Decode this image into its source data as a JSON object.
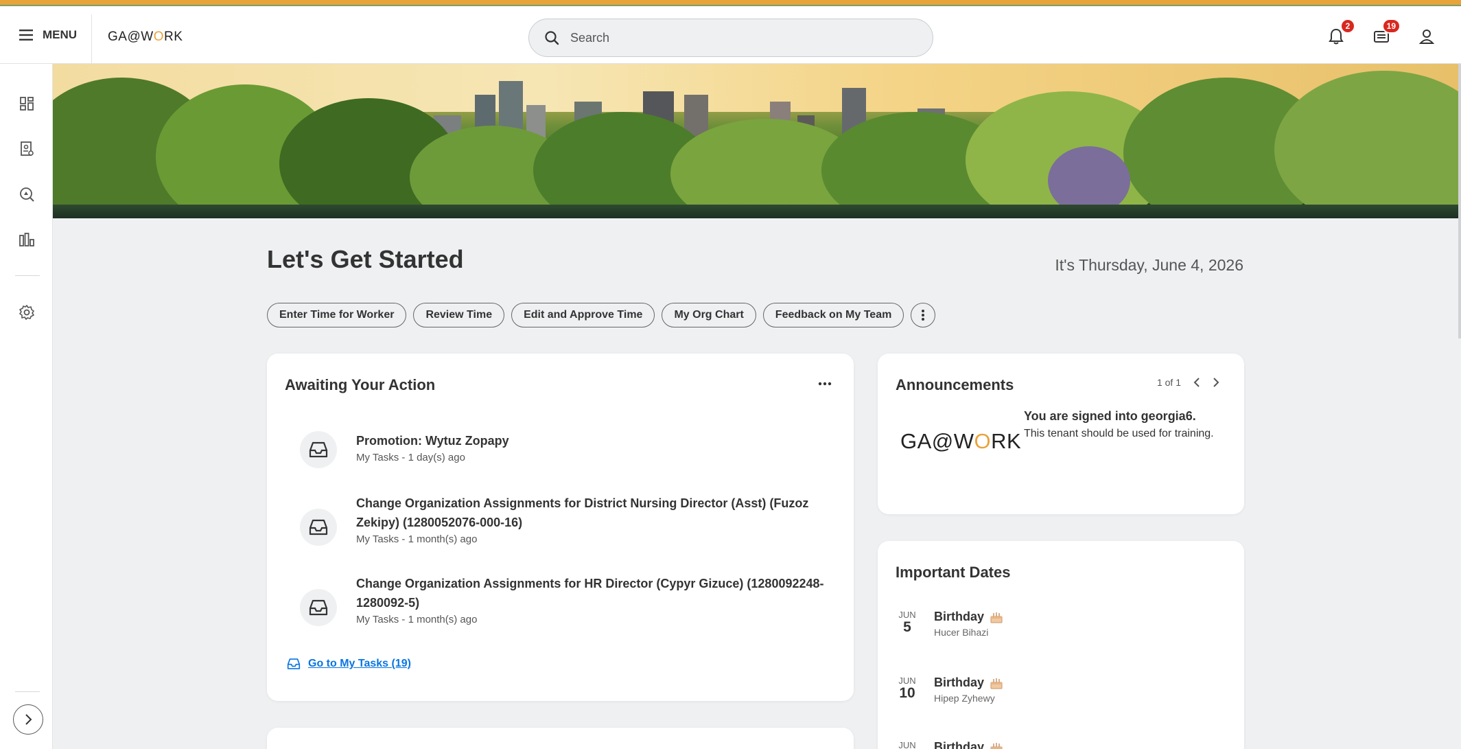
{
  "topbar": {
    "menu_label": "MENU",
    "logo": {
      "prefix": "GA@W",
      "o": "O",
      "suffix": "RK"
    },
    "search_placeholder": "Search",
    "notifications_count": "2",
    "inbox_count": "19"
  },
  "main": {
    "title": "Let's Get Started",
    "date": "It's Thursday, June 4, 2026",
    "quick_actions": [
      "Enter Time for Worker",
      "Review Time",
      "Edit and Approve Time",
      "My Org Chart",
      "Feedback on My Team"
    ]
  },
  "awaiting": {
    "title": "Awaiting Your Action",
    "tasks": [
      {
        "title": "Promotion: Wytuz Zopapy",
        "sub": "My Tasks - 1 day(s) ago"
      },
      {
        "title": "Change Organization Assignments for District Nursing Director (Asst) (Fuzoz Zekipy) (1280052076-000-16)",
        "sub": "My Tasks - 1 month(s) ago"
      },
      {
        "title": "Change Organization Assignments for HR Director (Cypyr Gizuce) (1280092248-1280092-5)",
        "sub": "My Tasks - 1 month(s) ago"
      }
    ],
    "goto_label": "Go to My Tasks (19)"
  },
  "announcements": {
    "title": "Announcements",
    "pager": "1 of 1",
    "heading": "You are signed into georgia6.",
    "body": "This tenant should be used for training."
  },
  "important_dates": {
    "title": "Important Dates",
    "items": [
      {
        "month": "JUN",
        "day": "5",
        "event": "Birthday",
        "person": "Hucer Bihazi"
      },
      {
        "month": "JUN",
        "day": "10",
        "event": "Birthday",
        "person": "Hipep Zyhewy"
      },
      {
        "month": "JUN",
        "day": "",
        "event": "Birthday",
        "person": ""
      }
    ]
  },
  "colors": {
    "accent": "#e8a33a",
    "link": "#0875e1",
    "badge": "#d9281f"
  }
}
